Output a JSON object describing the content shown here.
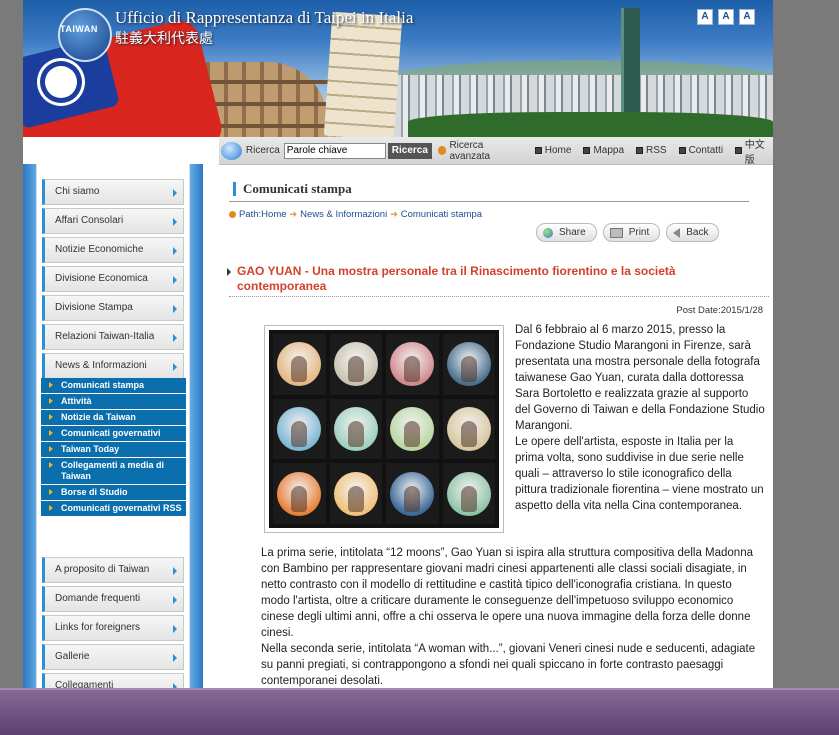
{
  "header": {
    "title": "Ufficio di Rappresentanza di Taipei in Italia",
    "subtitle": "駐義大利代表處",
    "logo_text": "TAIWAN",
    "font_sizes": [
      "A",
      "A",
      "A"
    ]
  },
  "toolbar": {
    "search_label": "Ricerca",
    "search_placeholder": "Parole chiave",
    "search_button": "Ricerca",
    "advanced_search": "Ricerca avanzata",
    "links": [
      "Home",
      "Mappa",
      "RSS",
      "Contatti",
      "中文版"
    ]
  },
  "sidebar": {
    "items_top": [
      "Chi siamo",
      "Affari Consolari",
      "Notizie Economiche",
      "Divisione Economica",
      "Divisione Stampa",
      "Relazioni Taiwan-Italia",
      "News & Informazioni"
    ],
    "sub_items": [
      "Comunicati stampa",
      "Attività",
      "Notizie da Taiwan",
      "Comunicati governativi",
      "Taiwan Today",
      "Collegamenti a media di Taiwan",
      "Borse di Studio",
      "Comunicati governativi RSS"
    ],
    "items_bottom": [
      "A proposito di Taiwan",
      "Domande frequenti",
      "Links for foreigners",
      "Gallerie",
      "Collegamenti"
    ]
  },
  "content": {
    "section_title": "Comunicati stampa",
    "breadcrumb": [
      "Path:Home",
      "News & Informazioni",
      "Comunicati stampa"
    ],
    "actions": [
      "Share",
      "Print",
      "Back"
    ],
    "article_title": "GAO YUAN - Una mostra personale tra il Rinascimento fiorentino e la società contemporanea",
    "post_date": "Post Date:2015/1/28",
    "side_paragraphs": [
      "Dal 6 febbraio al 6 marzo 2015, presso la Fondazione Studio Marangoni in Firenze, sarà presentata una mostra personale della fotografa taiwanese Gao Yuan, curata dalla dottoressa Sara Bortoletto e realizzata grazie al supporto del Governo di Taiwan e della Fondazione Studio Marangoni.",
      "Le opere dell'artista, esposte in Italia per la prima volta, sono suddivise in due serie nelle quali – attraverso lo stile iconografico della pittura tradizionale fiorentina – viene mostrato un aspetto della vita nella Cina contemporanea."
    ],
    "full_paragraphs": [
      "La prima serie, intitolata “12 moons”, Gao Yuan si ispira alla struttura compositiva della Madonna con Bambino per rappresentare giovani madri cinesi appartenenti alle classi sociali disagiate, in netto contrasto con il modello di rettitudine e castità tipico dell'iconografia cristiana. In questo modo l'artista, oltre a criticare duramente le conseguenze dell'impetuoso sviluppo economico cinese degli ultimi anni, offre a chi osserva le opere una nuova immagine della forza delle donne cinesi.",
      "Nella seconda serie, intitolata “A woman with...”, giovani Veneri cinesi nude e seducenti, adagiate su panni pregiati, si contrappongono a sfondi nei quali spiccano in forte contrasto paesaggi contemporanei desolati."
    ],
    "photo_colors": [
      "#e6b885",
      "#c9c4b0",
      "#d28a8f",
      "#4a6f8f",
      "#7fb6d4",
      "#9ed0c0",
      "#b9d7a3",
      "#d8c7a0",
      "#e8813b",
      "#f0c27a",
      "#3d6a9a",
      "#8fc3a8"
    ]
  },
  "colors": {
    "accent": "#2b8fd1",
    "submenu_bg": "#0b6fae",
    "title_red": "#d2422a"
  }
}
